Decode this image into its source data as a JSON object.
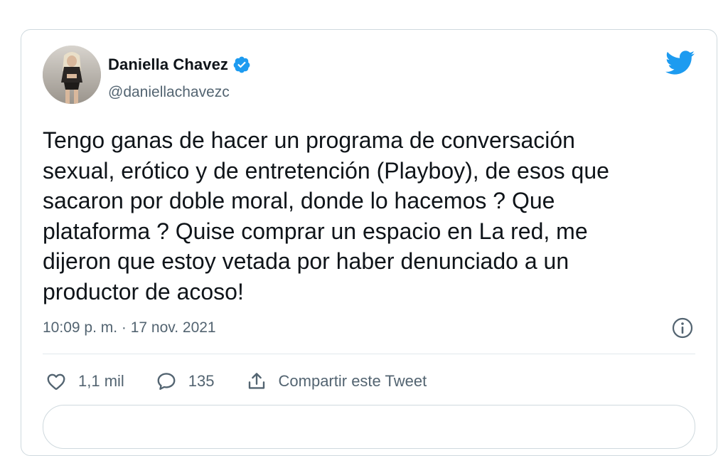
{
  "tweet": {
    "author_name": "Daniella Chavez",
    "author_handle": "@daniellachavezc",
    "verified": true,
    "text": "Tengo ganas de hacer un programa de conversación\nsexual, erótico y de entretención (Playboy), de esos que\nsacaron por doble moral, donde lo hacemos ? Que\nplataforma ? Quise comprar un espacio en La red, me\ndijeron que estoy vetada por haber denunciado a un\nproductor de acoso!",
    "timestamp": "10:09 p. m. · 17 nov. 2021"
  },
  "actions": {
    "like_count": "1,1 mil",
    "reply_count": "135",
    "share_label": "Compartir este Tweet"
  },
  "icons": {
    "brand": "twitter-bird-icon",
    "verified": "verified-badge-icon",
    "info": "info-icon",
    "like": "heart-icon",
    "reply": "speech-bubble-icon",
    "share": "share-icon"
  },
  "colors": {
    "brand_blue": "#1d9bf0",
    "text_primary": "#0f1419",
    "text_secondary": "#536471",
    "border": "#cfd9de"
  }
}
